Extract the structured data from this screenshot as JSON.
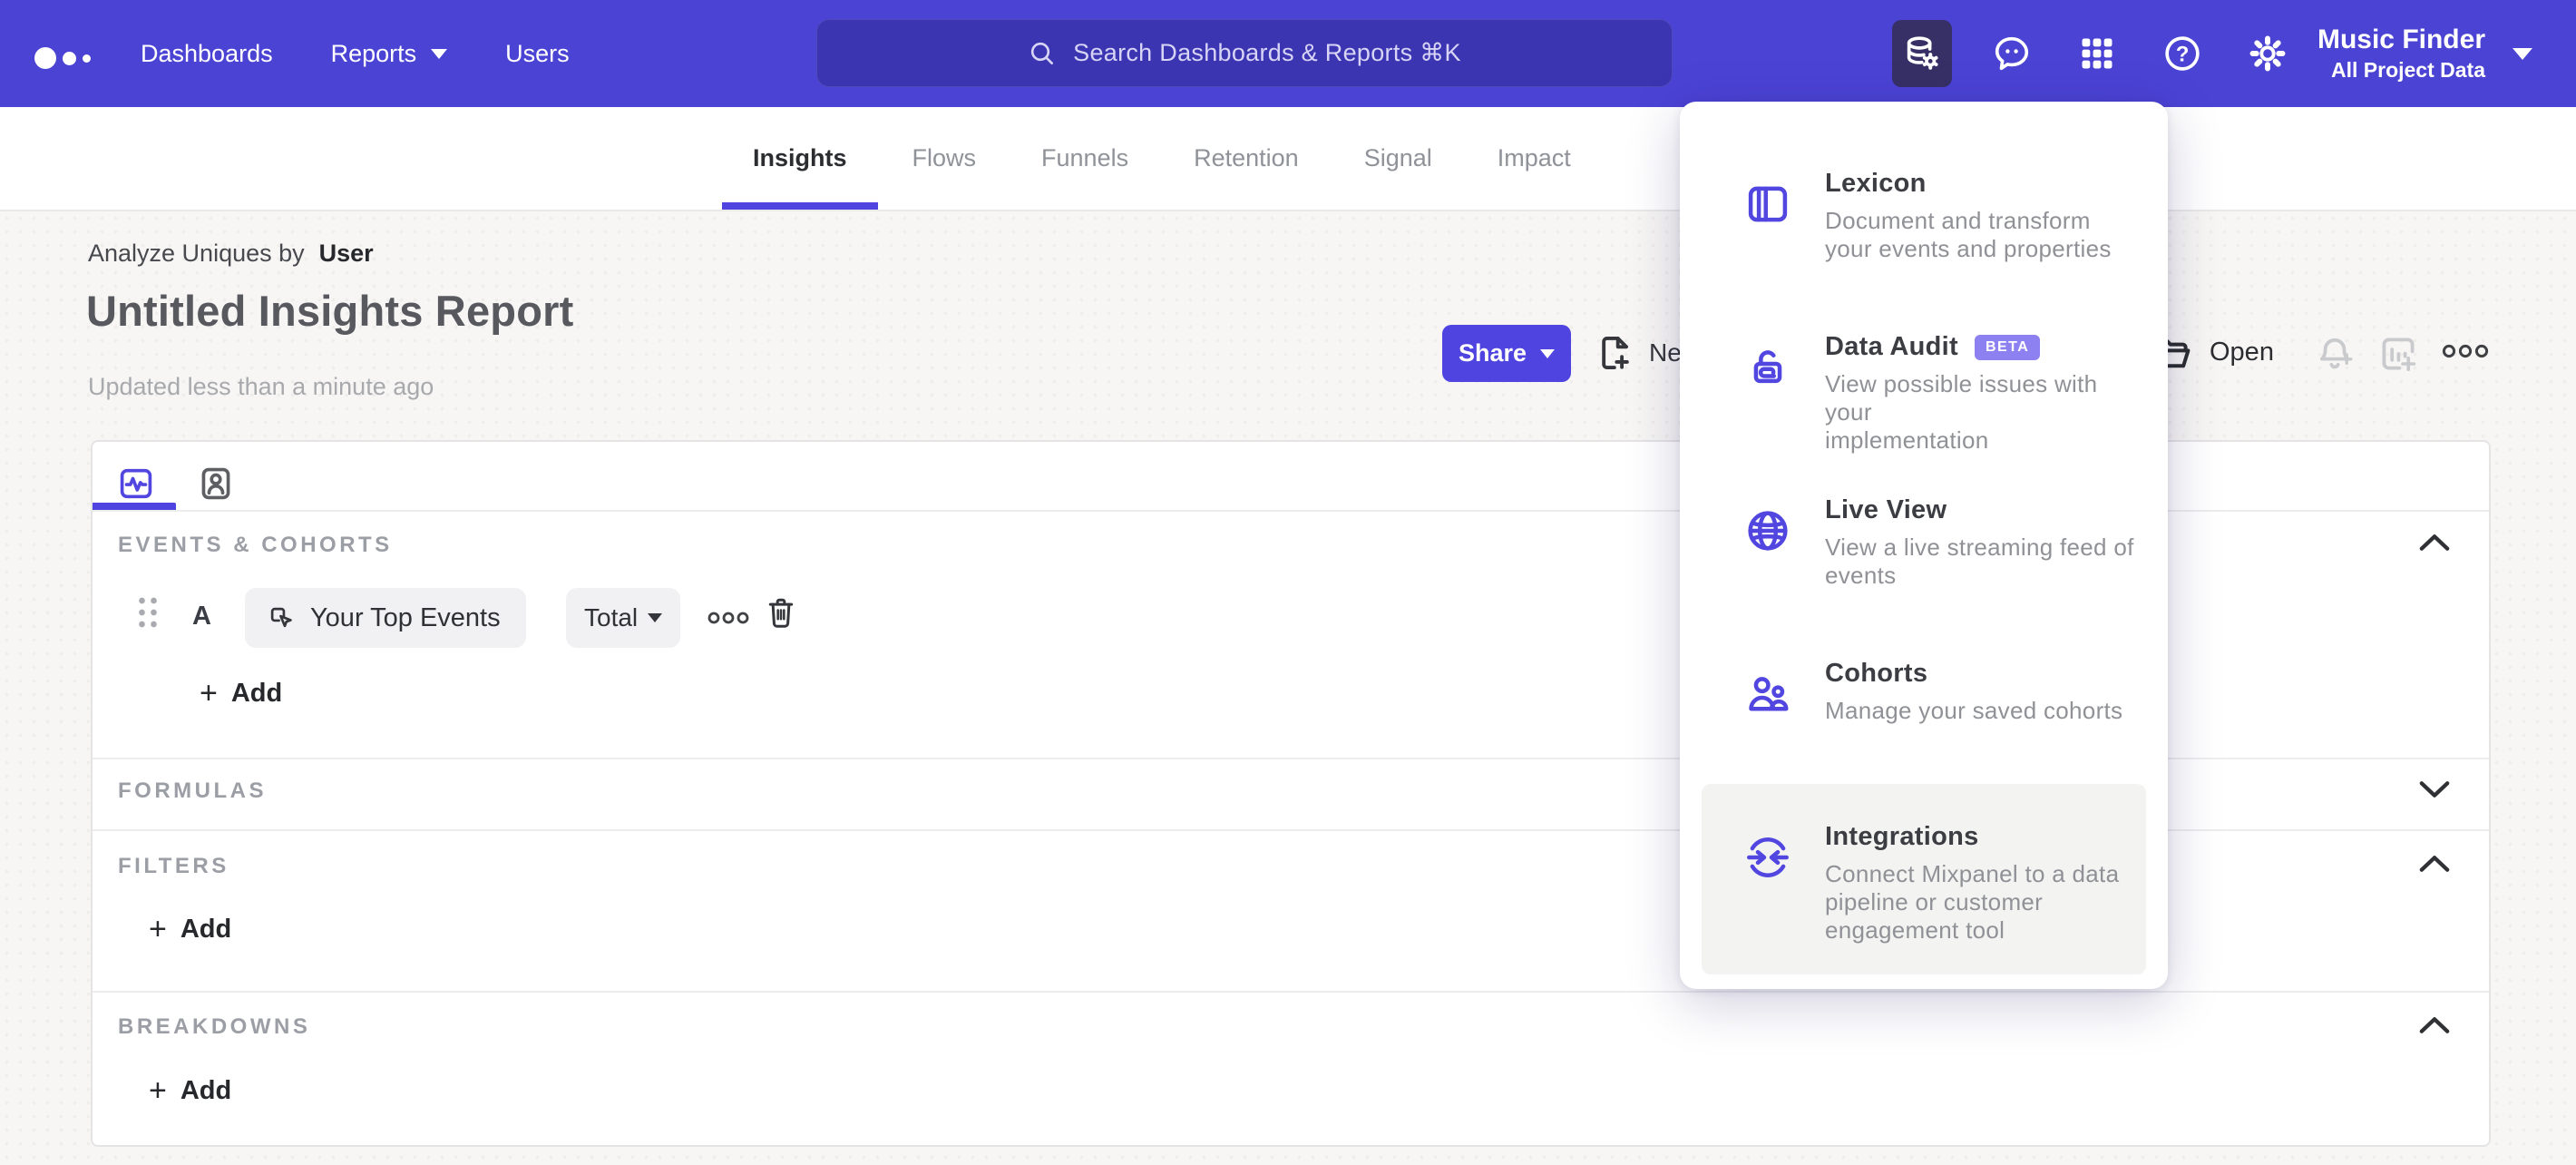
{
  "colors": {
    "navbar": "#4b43d4",
    "accent": "#4f44e0",
    "active_tool_bg": "#363066",
    "beta_badge": "#8d80f0"
  },
  "navbar": {
    "links": [
      {
        "label": "Dashboards",
        "has_caret": false
      },
      {
        "label": "Reports",
        "has_caret": true
      },
      {
        "label": "Users",
        "has_caret": false
      }
    ],
    "search_placeholder": "Search Dashboards & Reports ⌘K",
    "project": {
      "name": "Music Finder",
      "scope": "All Project Data"
    }
  },
  "report_tabs": {
    "active": "Insights",
    "items": [
      "Insights",
      "Flows",
      "Funnels",
      "Retention",
      "Signal",
      "Impact"
    ]
  },
  "header": {
    "analyze_label": "Analyze Uniques by",
    "analyze_value": "User",
    "title": "Untitled Insights Report",
    "updated": "Updated less than a minute ago",
    "share": "Share",
    "new": "New",
    "open": "Open"
  },
  "builder": {
    "sections": {
      "events": {
        "label": "EVENTS & COHORTS",
        "expanded": true
      },
      "formulas": {
        "label": "FORMULAS",
        "expanded": false
      },
      "filters": {
        "label": "FILTERS",
        "expanded": true
      },
      "breakdowns": {
        "label": "BREAKDOWNS",
        "expanded": true
      }
    },
    "event_row": {
      "letter": "A",
      "event_name": "Your Top Events",
      "aggregation": "Total"
    },
    "add_label": "Add"
  },
  "tools_menu": {
    "items": [
      {
        "title": "Lexicon",
        "badge": "",
        "desc": "Document and transform\nyour events and properties",
        "icon": "lexicon-book-icon",
        "highlighted": false
      },
      {
        "title": "Data Audit",
        "badge": "BETA",
        "desc": "View possible issues with your\nimplementation",
        "icon": "lock-audit-icon",
        "highlighted": false
      },
      {
        "title": "Live View",
        "badge": "",
        "desc": "View a live streaming feed of\nevents",
        "icon": "globe-icon",
        "highlighted": false
      },
      {
        "title": "Cohorts",
        "badge": "",
        "desc": "Manage your saved cohorts",
        "icon": "cohorts-people-icon",
        "highlighted": false
      },
      {
        "title": "Integrations",
        "badge": "",
        "desc": "Connect Mixpanel to a data\npipeline or customer\nengagement tool",
        "icon": "integrations-sync-icon",
        "highlighted": true
      }
    ]
  }
}
